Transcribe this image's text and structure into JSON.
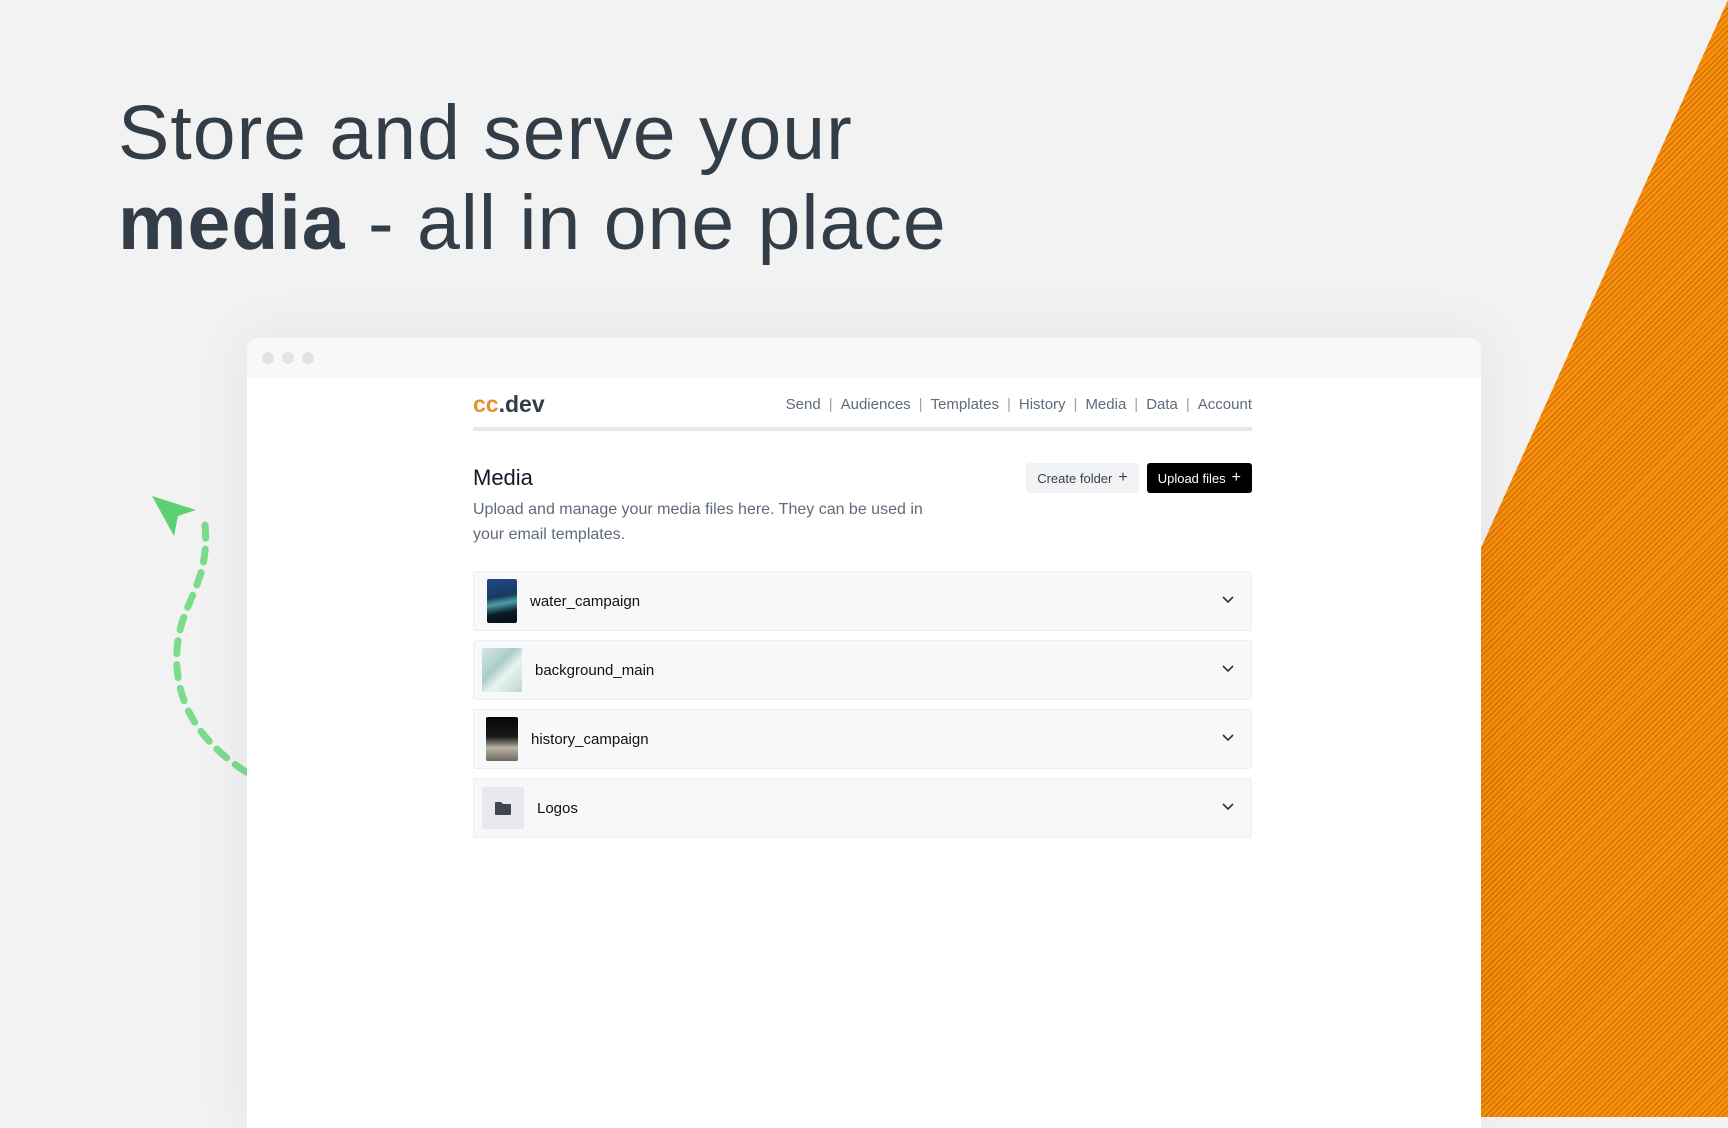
{
  "hero": {
    "line1": "Store and serve your",
    "line2_bold": "media",
    "line2_rest": " - all in one place"
  },
  "app": {
    "logo_accent": "cc",
    "logo_rest": ".dev",
    "nav": [
      "Send",
      "Audiences",
      "Templates",
      "History",
      "Media",
      "Data",
      "Account"
    ],
    "nav_separator": "|"
  },
  "page": {
    "title": "Media",
    "description": "Upload and manage your media files here. They can be used in your email templates.",
    "create_folder_label": "Create folder",
    "upload_files_label": "Upload files"
  },
  "media_items": [
    {
      "name": "water_campaign",
      "kind": "image",
      "icon": "image-thumbnail"
    },
    {
      "name": "background_main",
      "kind": "image",
      "icon": "image-thumbnail"
    },
    {
      "name": "history_campaign",
      "kind": "image",
      "icon": "image-thumbnail"
    },
    {
      "name": "Logos",
      "kind": "folder",
      "icon": "folder-icon"
    }
  ],
  "colors": {
    "accent_orange": "#f9900d",
    "logo_orange": "#e8902f",
    "arrow_green": "#6ed47e",
    "heading_text": "#333d47"
  }
}
